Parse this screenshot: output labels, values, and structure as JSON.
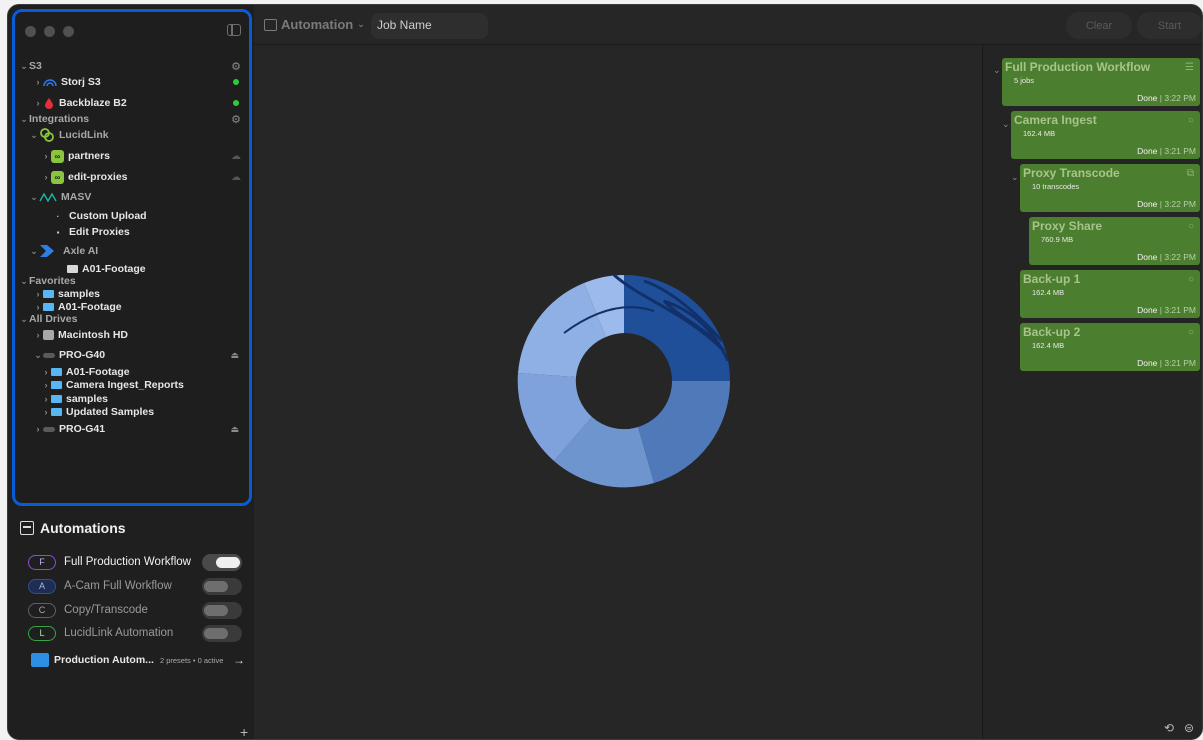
{
  "sidebar": {
    "sections": {
      "s3": "S3",
      "integrations": "Integrations",
      "favorites": "Favorites",
      "all_drives": "All Drives"
    },
    "s3_items": [
      "Storj S3",
      "Backblaze B2"
    ],
    "lucidlink": {
      "label": "LucidLink",
      "items": [
        "partners",
        "edit-proxies"
      ]
    },
    "masv": {
      "label": "MASV",
      "items": [
        "Custom Upload",
        "Edit Proxies"
      ]
    },
    "axle": {
      "label": "Axle AI",
      "items": [
        "A01-Footage"
      ]
    },
    "favorites": [
      "samples",
      "A01-Footage"
    ],
    "drives": {
      "macintosh": "Macintosh HD",
      "pro_g40": "PRO-G40",
      "pro_g40_items": [
        "A01-Footage",
        "Camera Ingest_Reports",
        "samples",
        "Updated Samples"
      ],
      "pro_g41": "PRO-G41"
    }
  },
  "automations": {
    "title": "Automations",
    "items": [
      {
        "badge": "F",
        "label": "Full Production Workflow",
        "enabled": true,
        "color": "#8a4fd8"
      },
      {
        "badge": "A",
        "label": "A-Cam Full Workflow",
        "enabled": false,
        "color": "#2f4f9a"
      },
      {
        "badge": "C",
        "label": "Copy/Transcode",
        "enabled": false,
        "color": "#5a6170"
      },
      {
        "badge": "L",
        "label": "LucidLink Automation",
        "enabled": false,
        "color": "#36a348"
      }
    ],
    "preset_folder": {
      "label": "Production Autom...",
      "meta": "2 presets • 0 active"
    }
  },
  "toolbar": {
    "automation_label": "Automation",
    "job_name": "Job Name",
    "clear": "Clear",
    "start": "Start"
  },
  "jobs": [
    {
      "title": "Full Production Workflow",
      "sub": "5 jobs",
      "status": "Done",
      "time": "3:22 PM"
    },
    {
      "title": "Camera Ingest",
      "sub": "162.4 MB",
      "status": "Done",
      "time": "3:21 PM"
    },
    {
      "title": "Proxy Transcode",
      "sub": "10 transcodes",
      "status": "Done",
      "time": "3:22 PM"
    },
    {
      "title": "Proxy Share",
      "sub": "760.9 MB",
      "status": "Done",
      "time": "3:22 PM"
    },
    {
      "title": "Back-up 1",
      "sub": "162.4 MB",
      "status": "Done",
      "time": "3:21 PM"
    },
    {
      "title": "Back-up 2",
      "sub": "162.4 MB",
      "status": "Done",
      "time": "3:21 PM"
    }
  ],
  "colors": {
    "accent": "#0a5bd6",
    "job_card": "#4c7e30",
    "online": "#2ecb3d"
  }
}
